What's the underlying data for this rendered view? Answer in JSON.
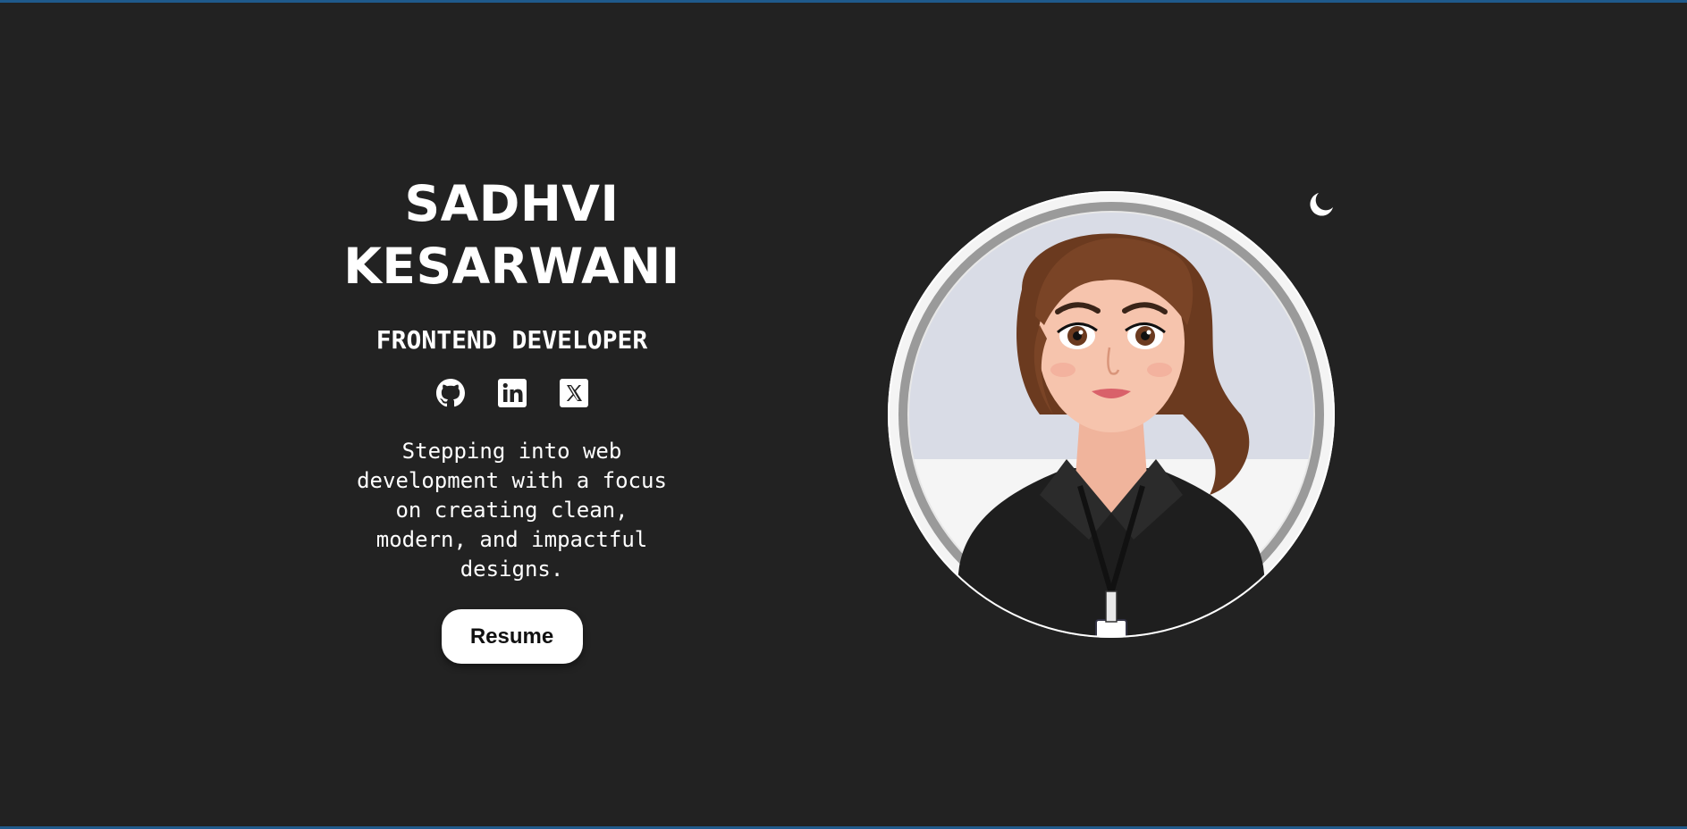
{
  "hero": {
    "name_line1": "SADHVI",
    "name_line2": "KESARWANI",
    "role": "FRONTEND DEVELOPER",
    "bio_lines": [
      "Stepping into web",
      "development with a focus",
      "on creating clean,",
      "modern, and impactful",
      "designs."
    ],
    "resume_label": "Resume"
  },
  "socials": [
    {
      "icon": "github-icon"
    },
    {
      "icon": "linkedin-icon"
    },
    {
      "icon": "x-icon"
    }
  ],
  "theme_toggle": {
    "icon": "moon-icon"
  },
  "colors": {
    "background": "#222222",
    "text": "#ffffff",
    "button_bg": "#ffffff",
    "button_text": "#111111",
    "frame_border": "#1f5a8c"
  }
}
